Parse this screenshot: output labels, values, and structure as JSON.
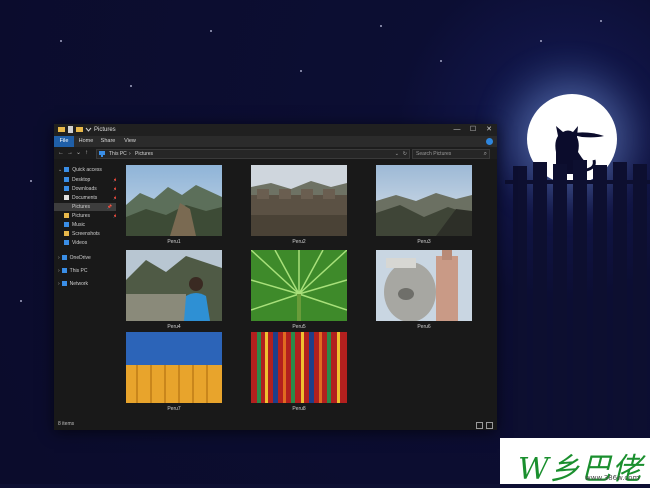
{
  "window": {
    "title": "Pictures",
    "controls": [
      "—",
      "☐",
      "✕"
    ]
  },
  "ribbon": {
    "tabs": [
      "File",
      "Home",
      "Share",
      "View"
    ]
  },
  "address": {
    "crumbs": [
      "This PC",
      "›",
      "Pictures"
    ],
    "search_placeholder": "Search Pictures"
  },
  "nav": {
    "items": [
      {
        "label": "Quick access",
        "icon": "star-icon",
        "color": "#3a8ee6"
      },
      {
        "label": "Desktop",
        "icon": "desktop-icon",
        "color": "#3a8ee6"
      },
      {
        "label": "Downloads",
        "icon": "download-icon",
        "color": "#3a8ee6"
      },
      {
        "label": "Documents",
        "icon": "document-icon",
        "color": "#e0e0e0"
      },
      {
        "label": "Pictures",
        "icon": "pictures-icon",
        "color": "#3a8ee6"
      },
      {
        "label": "Pictures",
        "icon": "folder-icon",
        "color": "#e8b84a"
      },
      {
        "label": "Music",
        "icon": "music-icon",
        "color": "#3a8ee6"
      },
      {
        "label": "Screenshots",
        "icon": "folder-icon",
        "color": "#e8b84a"
      },
      {
        "label": "Videos",
        "icon": "video-icon",
        "color": "#3a8ee6"
      },
      {
        "label": "OneDrive",
        "icon": "cloud-icon",
        "color": "#3a8ee6"
      },
      {
        "label": "This PC",
        "icon": "computer-icon",
        "color": "#3a8ee6"
      },
      {
        "label": "Network",
        "icon": "network-icon",
        "color": "#3a8ee6"
      }
    ]
  },
  "files": [
    {
      "label": "Peru1"
    },
    {
      "label": "Peru2"
    },
    {
      "label": "Peru3"
    },
    {
      "label": "Peru4"
    },
    {
      "label": "Peru5"
    },
    {
      "label": "Peru6"
    },
    {
      "label": "Peru7"
    },
    {
      "label": "Peru8"
    }
  ],
  "status": {
    "text": "8 items"
  },
  "watermark": {
    "text": "W乡巴佬",
    "url": "www.386w.com"
  }
}
